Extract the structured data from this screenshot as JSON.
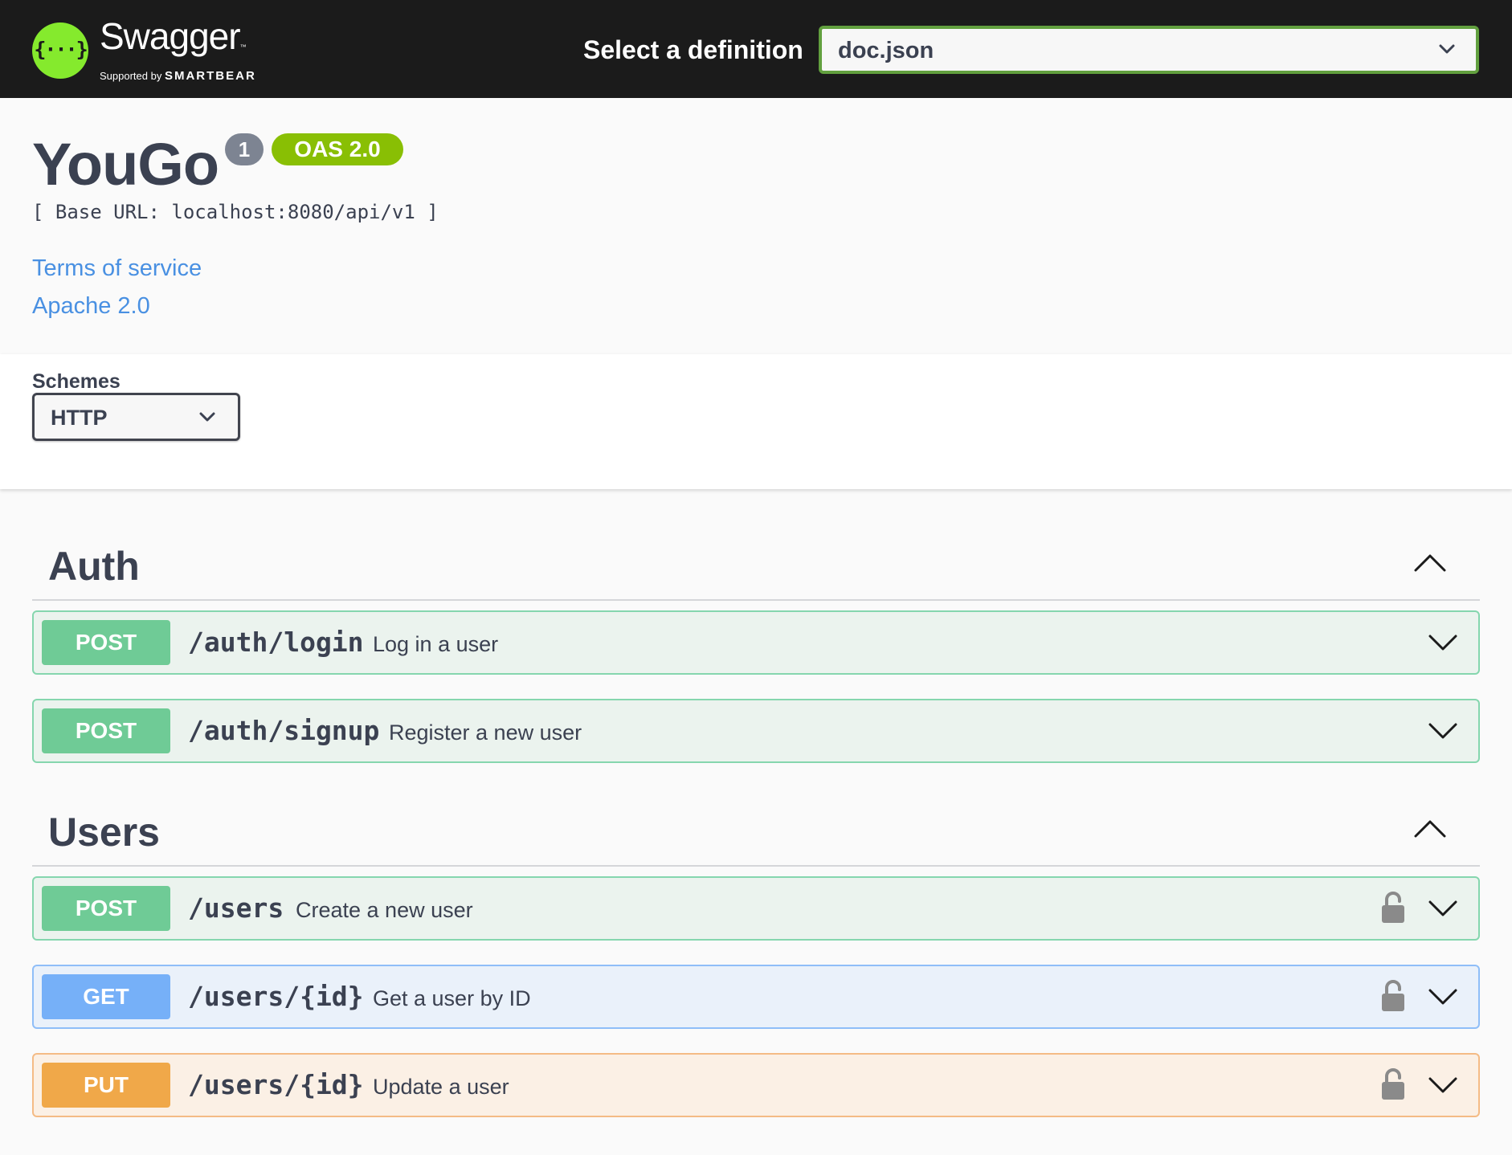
{
  "topbar": {
    "logo_name": "Swagger",
    "logo_supported": "Supported by",
    "logo_brand": "SMARTBEAR",
    "definition_label": "Select a definition",
    "definition_value": "doc.json"
  },
  "info": {
    "title": "YouGo",
    "version": "1",
    "oas": "OAS 2.0",
    "base_url": "[ Base URL: localhost:8080/api/v1 ]",
    "terms_link": "Terms of service",
    "license_link": "Apache 2.0"
  },
  "schemes": {
    "label": "Schemes",
    "value": "HTTP"
  },
  "tags": [
    {
      "name": "Auth",
      "operations": [
        {
          "method": "POST",
          "path": "/auth/login",
          "summary": "Log in a user",
          "locked": false
        },
        {
          "method": "POST",
          "path": "/auth/signup",
          "summary": "Register a new user",
          "locked": false
        }
      ]
    },
    {
      "name": "Users",
      "operations": [
        {
          "method": "POST",
          "path": "/users",
          "summary": "Create a new user",
          "locked": true
        },
        {
          "method": "GET",
          "path": "/users/{id}",
          "summary": "Get a user by ID",
          "locked": true
        },
        {
          "method": "PUT",
          "path": "/users/{id}",
          "summary": "Update a user",
          "locked": true
        }
      ]
    }
  ],
  "icons": {
    "logo": "swagger-logo-icon",
    "dropdown": "chevron-down-icon",
    "collapse": "chevron-up-icon",
    "expand": "chevron-down-icon",
    "lock": "lock-open-icon"
  },
  "colors": {
    "topbar": "#1b1b1b",
    "logo_green": "#85ea2d",
    "post": "#49cc90",
    "get": "#61affe",
    "put": "#fca130",
    "link": "#4990e2"
  }
}
